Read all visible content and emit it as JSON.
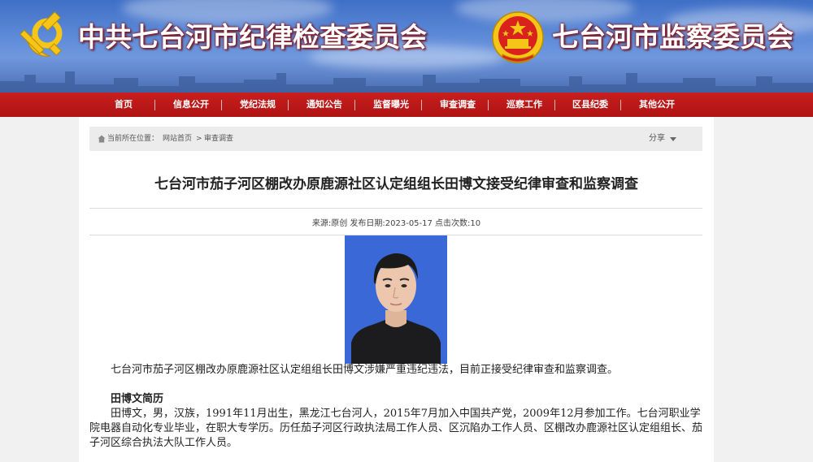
{
  "header": {
    "left_title": "中共七台河市纪律检查委员会",
    "right_title": "七台河市监察委员会",
    "colors": {
      "banner_blue": "#5a87d6",
      "title_shadow": "#8f1216",
      "party_red": "#d9221c",
      "emblem_gold": "#f5c518"
    },
    "icons": {
      "left_emblem": "hammer-sickle-emblem",
      "right_emblem": "national-emblem"
    }
  },
  "nav": {
    "background": "#b8151a",
    "items": [
      "首页",
      "信息公开",
      "党纪法规",
      "通知公告",
      "监督曝光",
      "审查调查",
      "巡察工作",
      "区县纪委",
      "其他公开"
    ]
  },
  "breadcrumb": {
    "icon": "home-icon",
    "label": "当前所在位置：",
    "home": "网站首页",
    "separator": ">",
    "current": "审查调查",
    "share_label": "分享",
    "share_icon": "caret-down-icon"
  },
  "article": {
    "title": "七台河市茄子河区棚改办原鹿源社区认定组组长田博文接受纪律审查和监察调查",
    "meta": "来源:原创 发布日期:2023-05-17 点击次数:10",
    "photo": "portrait-photo",
    "paragraph_1": "七台河市茄子河区棚改办原鹿源社区认定组组长田博文涉嫌严重违纪违法，目前正接受纪律审查和监察调查。",
    "subheading": "田博文简历",
    "paragraph_2": "田博文，男，汉族，1991年11月出生，黑龙江七台河人，2015年7月加入中国共产党，2009年12月参加工作。七台河职业学院电器自动化专业毕业，在职大专学历。历任茄子河区行政执法局工作人员、区沉陷办工作人员、区棚改办鹿源社区认定组组长、茄子河区综合执法大队工作人员。"
  }
}
